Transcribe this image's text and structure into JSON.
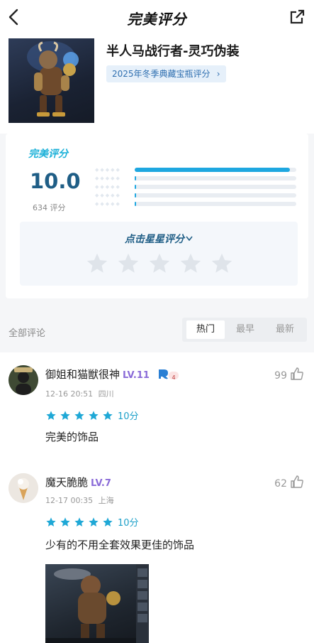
{
  "header": {
    "logo_text": "完美评分",
    "back_icon": "chevron-left-icon",
    "share_icon": "share-icon"
  },
  "item": {
    "title": "半人马战行者-灵巧伪装",
    "tag": "2025年冬季典藏宝瓶评分",
    "tag_chevron": "›"
  },
  "rating": {
    "brand": "完美评分",
    "score": "10.0",
    "count": "634 评分",
    "distribution": [
      0.96,
      0.0,
      0.0,
      0.0,
      0.0
    ],
    "prompt": "点击星星评分",
    "prompt_icon": "chevron-down-icon",
    "star_icon": "star-outline-icon"
  },
  "comments_header": {
    "all_label": "全部评论",
    "tabs": [
      "热门",
      "最早",
      "最新"
    ],
    "active_tab": "热门"
  },
  "comments": [
    {
      "username": "御姐和猫獣很神",
      "level": "LV.11",
      "badge_text": "4",
      "datetime": "12-16 20:51",
      "location": "四川",
      "likes": "99",
      "stars": 5,
      "score_label": "10分",
      "text": "完美的饰品"
    },
    {
      "username": "魔天脆脆",
      "level": "LV.7",
      "datetime": "12-17 00:35",
      "location": "上海",
      "likes": "62",
      "stars": 5,
      "score_label": "10分",
      "text": "少有的不用全套效果更佳的饰品"
    }
  ],
  "colors": {
    "accent": "#1ea7e0",
    "score_blue": "#1f5e86",
    "level_purple": "#8a6bd8",
    "tag_bg": "#e6f0fa"
  }
}
